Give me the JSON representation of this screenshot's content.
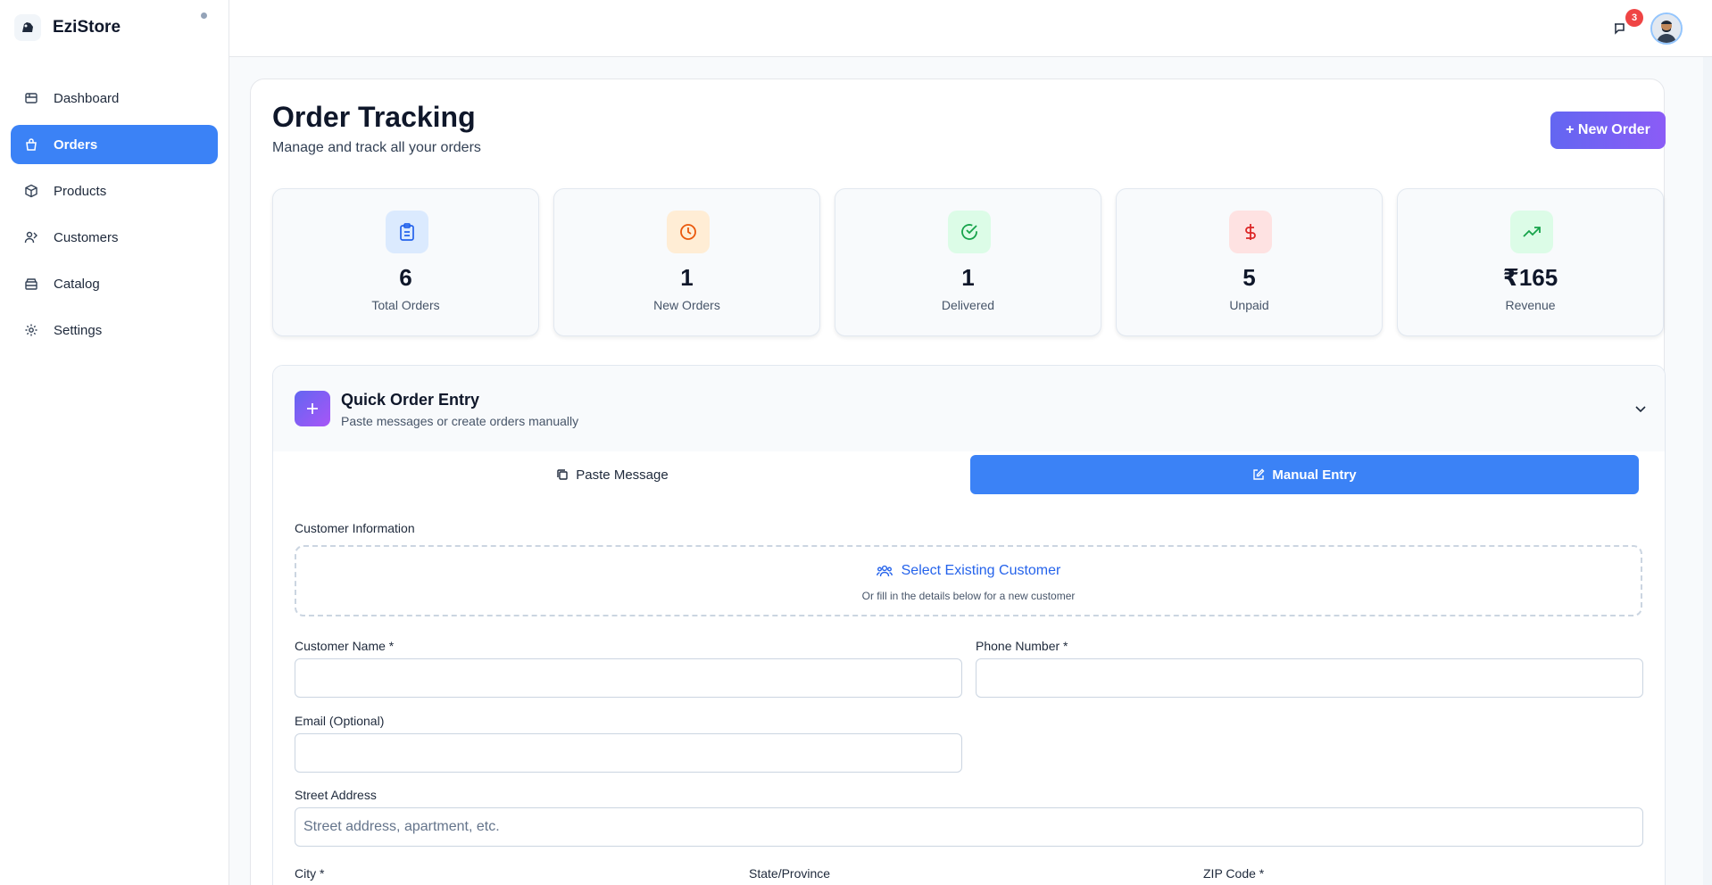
{
  "brand": {
    "name": "EziStore"
  },
  "sidebar": {
    "items": [
      {
        "label": "Dashboard",
        "icon": "dashboard-icon"
      },
      {
        "label": "Orders",
        "icon": "bag-icon",
        "active": true
      },
      {
        "label": "Products",
        "icon": "box-icon"
      },
      {
        "label": "Customers",
        "icon": "users-icon"
      },
      {
        "label": "Catalog",
        "icon": "catalog-icon"
      },
      {
        "label": "Settings",
        "icon": "gear-icon"
      }
    ]
  },
  "topbar": {
    "notification_count": "3"
  },
  "page": {
    "title": "Order Tracking",
    "subtitle": "Manage and track all your orders",
    "new_order_label": "+ New Order"
  },
  "stats": [
    {
      "value": "6",
      "label": "Total Orders",
      "icon": "clipboard-icon",
      "bg": "#dbeafe",
      "color": "#2563eb"
    },
    {
      "value": "1",
      "label": "New Orders",
      "icon": "clock-icon",
      "bg": "#ffedd5",
      "color": "#ea580c"
    },
    {
      "value": "1",
      "label": "Delivered",
      "icon": "check-circle-icon",
      "bg": "#dcfce7",
      "color": "#16a34a"
    },
    {
      "value": "5",
      "label": "Unpaid",
      "icon": "dollar-icon",
      "bg": "#fee2e2",
      "color": "#dc2626"
    },
    {
      "value": "₹165",
      "label": "Revenue",
      "icon": "trending-up-icon",
      "bg": "#dcfce7",
      "color": "#16a34a"
    }
  ],
  "quick_entry": {
    "title": "Quick Order Entry",
    "subtitle": "Paste messages or create orders manually",
    "tabs": {
      "paste": "Paste Message",
      "manual": "Manual Entry"
    },
    "customer_info_label": "Customer Information",
    "select_existing": "Select Existing Customer",
    "select_hint": "Or fill in the details below for a new customer",
    "fields": {
      "customer_name": {
        "label": "Customer Name *",
        "value": ""
      },
      "phone": {
        "label": "Phone Number *",
        "value": ""
      },
      "email": {
        "label": "Email (Optional)",
        "value": ""
      },
      "street": {
        "label": "Street Address",
        "placeholder": "Street address, apartment, etc."
      },
      "city": {
        "label": "City *"
      },
      "state": {
        "label": "State/Province"
      },
      "zip": {
        "label": "ZIP Code *"
      }
    }
  }
}
